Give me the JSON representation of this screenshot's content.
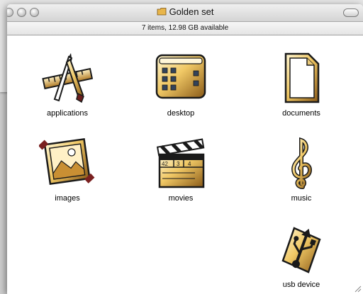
{
  "window": {
    "title": "Golden set",
    "status": "7 items, 12.98 GB available"
  },
  "items": [
    {
      "label": "applications",
      "icon": "applications-icon"
    },
    {
      "label": "desktop",
      "icon": "desktop-icon"
    },
    {
      "label": "documents",
      "icon": "documents-icon"
    },
    {
      "label": "images",
      "icon": "images-icon"
    },
    {
      "label": "movies",
      "icon": "movies-icon"
    },
    {
      "label": "music",
      "icon": "music-icon"
    },
    {
      "label": "usb device",
      "icon": "usb-device-icon"
    }
  ],
  "movie_clapper": {
    "scene": "42",
    "take": "3",
    "roll": "4"
  },
  "colors": {
    "gold_light": "#f3d98a",
    "gold_dark": "#8a5a17",
    "outline": "#1a1a1a"
  }
}
